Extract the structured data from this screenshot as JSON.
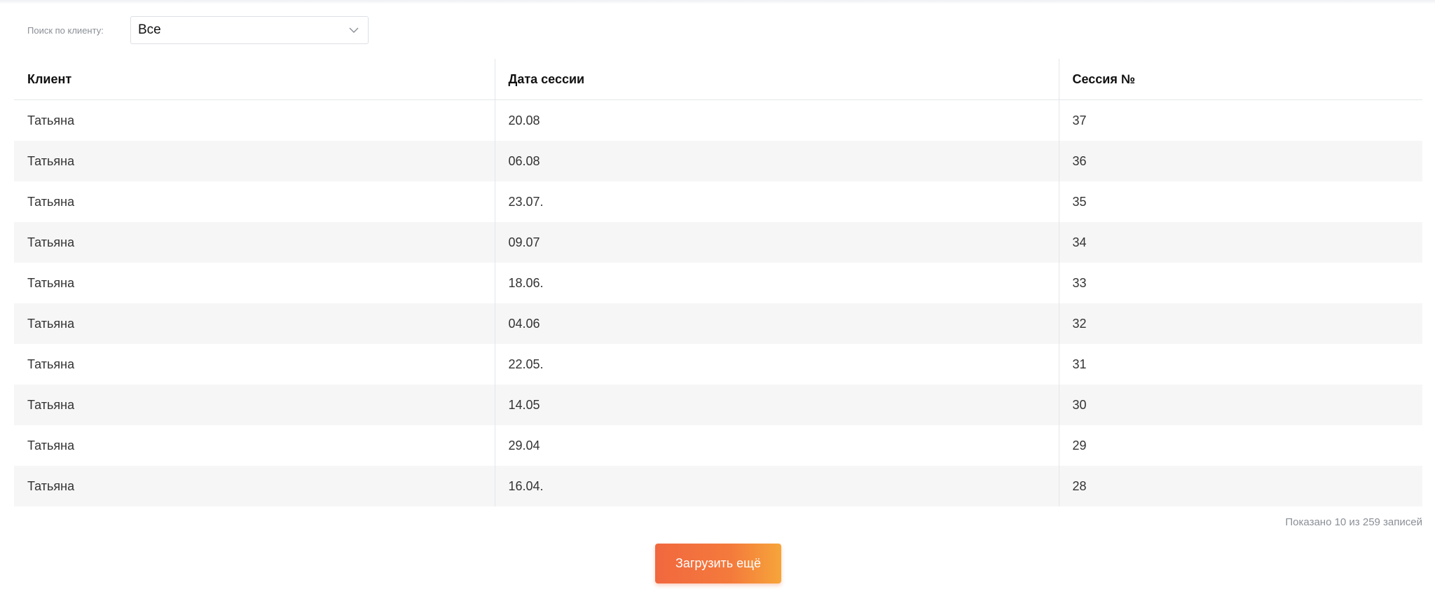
{
  "filter": {
    "label": "Поиск по клиенту:",
    "selected": "Все"
  },
  "table": {
    "columns": [
      "Клиент",
      "Дата сессии",
      "Сессия №"
    ],
    "rows": [
      {
        "client": "Татьяна",
        "date": "20.08",
        "session": "37"
      },
      {
        "client": "Татьяна",
        "date": "06.08",
        "session": "36"
      },
      {
        "client": "Татьяна",
        "date": "23.07.",
        "session": "35"
      },
      {
        "client": "Татьяна",
        "date": "09.07",
        "session": "34"
      },
      {
        "client": "Татьяна",
        "date": "18.06.",
        "session": "33"
      },
      {
        "client": "Татьяна",
        "date": "04.06",
        "session": "32"
      },
      {
        "client": "Татьяна",
        "date": "22.05.",
        "session": "31"
      },
      {
        "client": "Татьяна",
        "date": "14.05",
        "session": "30"
      },
      {
        "client": "Татьяна",
        "date": "29.04",
        "session": "29"
      },
      {
        "client": "Татьяна",
        "date": "16.04.",
        "session": "28"
      }
    ]
  },
  "footer": {
    "count_text": "Показано 10 из 259 записей",
    "load_more_label": "Загрузить ещё"
  },
  "colors": {
    "accent_start": "#f1683f",
    "accent_end": "#f6a53a",
    "row_stripe": "#f6f6f7"
  },
  "icons": {
    "select_chevron": "chevron-down-icon"
  }
}
